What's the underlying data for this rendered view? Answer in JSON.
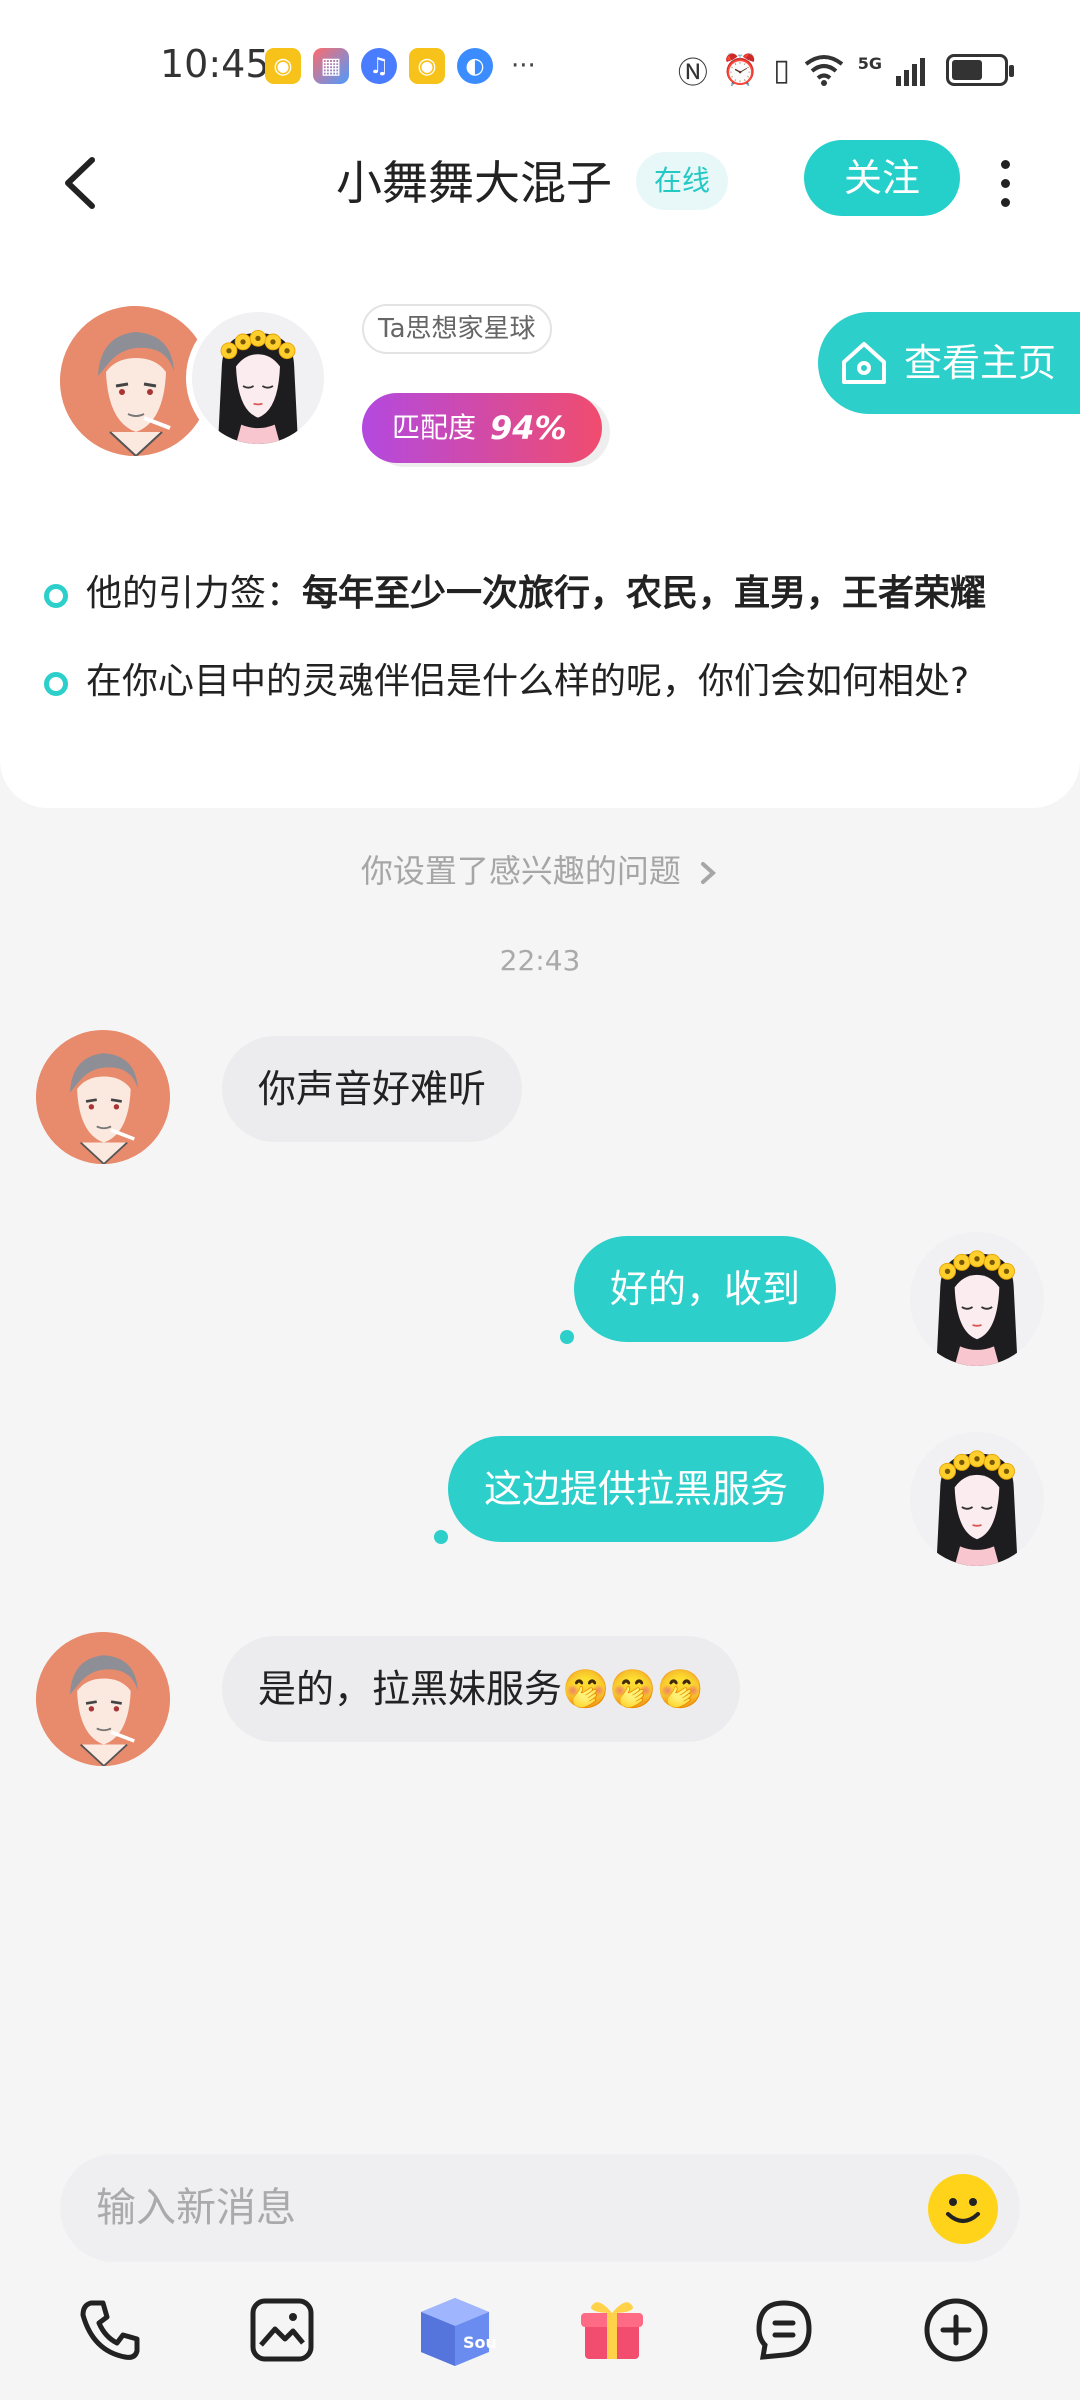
{
  "status_bar": {
    "time": "10:45",
    "network": "5G",
    "battery_percent": 60
  },
  "header": {
    "title": "小舞舞大混子",
    "online_badge": "在线",
    "follow_label": "关注"
  },
  "profile_card": {
    "planet_tag": "Ta思想家星球",
    "match_label": "匹配度",
    "match_value": "94%",
    "homepage_label": "查看主页",
    "tags_prefix": "他的引力签：",
    "tags_text": "每年至少一次旅行，农民，直男，王者荣耀",
    "question": "在你心目中的灵魂伴侣是什么样的呢，你们会如何相处?"
  },
  "chat": {
    "notice": "你设置了感兴趣的问题",
    "timestamp": "22:43",
    "messages": [
      {
        "from": "other",
        "text": "你声音好难听"
      },
      {
        "from": "me",
        "text": "好的，收到"
      },
      {
        "from": "me",
        "text": "这边提供拉黑服务"
      },
      {
        "from": "other",
        "text": "是的，拉黑妹服务🤭🤭🤭"
      }
    ]
  },
  "input": {
    "placeholder": "输入新消息"
  },
  "toolbar": {
    "items": [
      "phone-icon",
      "image-icon",
      "soul-box-icon",
      "gift-icon",
      "voice-match-icon",
      "add-icon"
    ],
    "soul_label": "Soul"
  },
  "colors": {
    "accent": "#2ccfca",
    "match_gradient_start": "#b349e0",
    "match_gradient_end": "#f04c6e",
    "bubble_in": "#ececee"
  }
}
